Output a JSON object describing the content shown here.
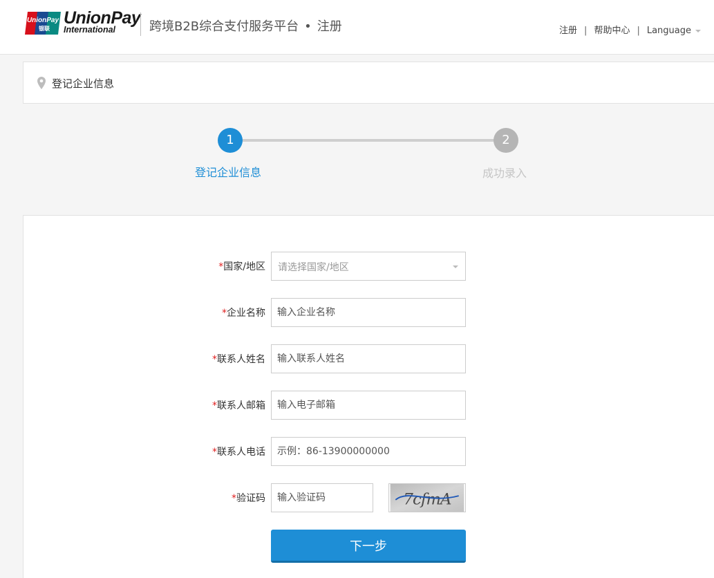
{
  "header": {
    "logo": {
      "badge_text": "UnionPay",
      "badge_subtext": "银联",
      "line1": "UnionPay",
      "line2": "International"
    },
    "title": "跨境B2B综合支付服务平台",
    "dot": "•",
    "subtitle": "注册",
    "links": {
      "register": "注册",
      "help": "帮助中心",
      "language": "Language",
      "separator": "|"
    }
  },
  "breadcrumb": {
    "icon": "location-pin-icon",
    "text": "登记企业信息"
  },
  "steps": [
    {
      "number": "1",
      "label": "登记企业信息",
      "status": "active"
    },
    {
      "number": "2",
      "label": "成功录入",
      "status": "inactive"
    }
  ],
  "form": {
    "required_mark": "*",
    "fields": [
      {
        "label": "国家/地区",
        "placeholder": "请选择国家/地区",
        "type": "select"
      },
      {
        "label": "企业名称",
        "placeholder": "输入企业名称",
        "type": "text"
      },
      {
        "label": "联系人姓名",
        "placeholder": "输入联系人姓名",
        "type": "text"
      },
      {
        "label": "联系人邮箱",
        "placeholder": "输入电子邮箱",
        "type": "text"
      },
      {
        "label": "联系人电话",
        "placeholder": "示例：86-13900000000",
        "type": "text"
      },
      {
        "label": "验证码",
        "placeholder": "输入验证码",
        "type": "captcha"
      }
    ],
    "captcha_text": "7cfmA",
    "submit_label": "下一步"
  },
  "colors": {
    "accent": "#1e8ed6",
    "step_inactive": "#b5b5b5",
    "required": "#e02020",
    "background": "#f5f5f5"
  }
}
